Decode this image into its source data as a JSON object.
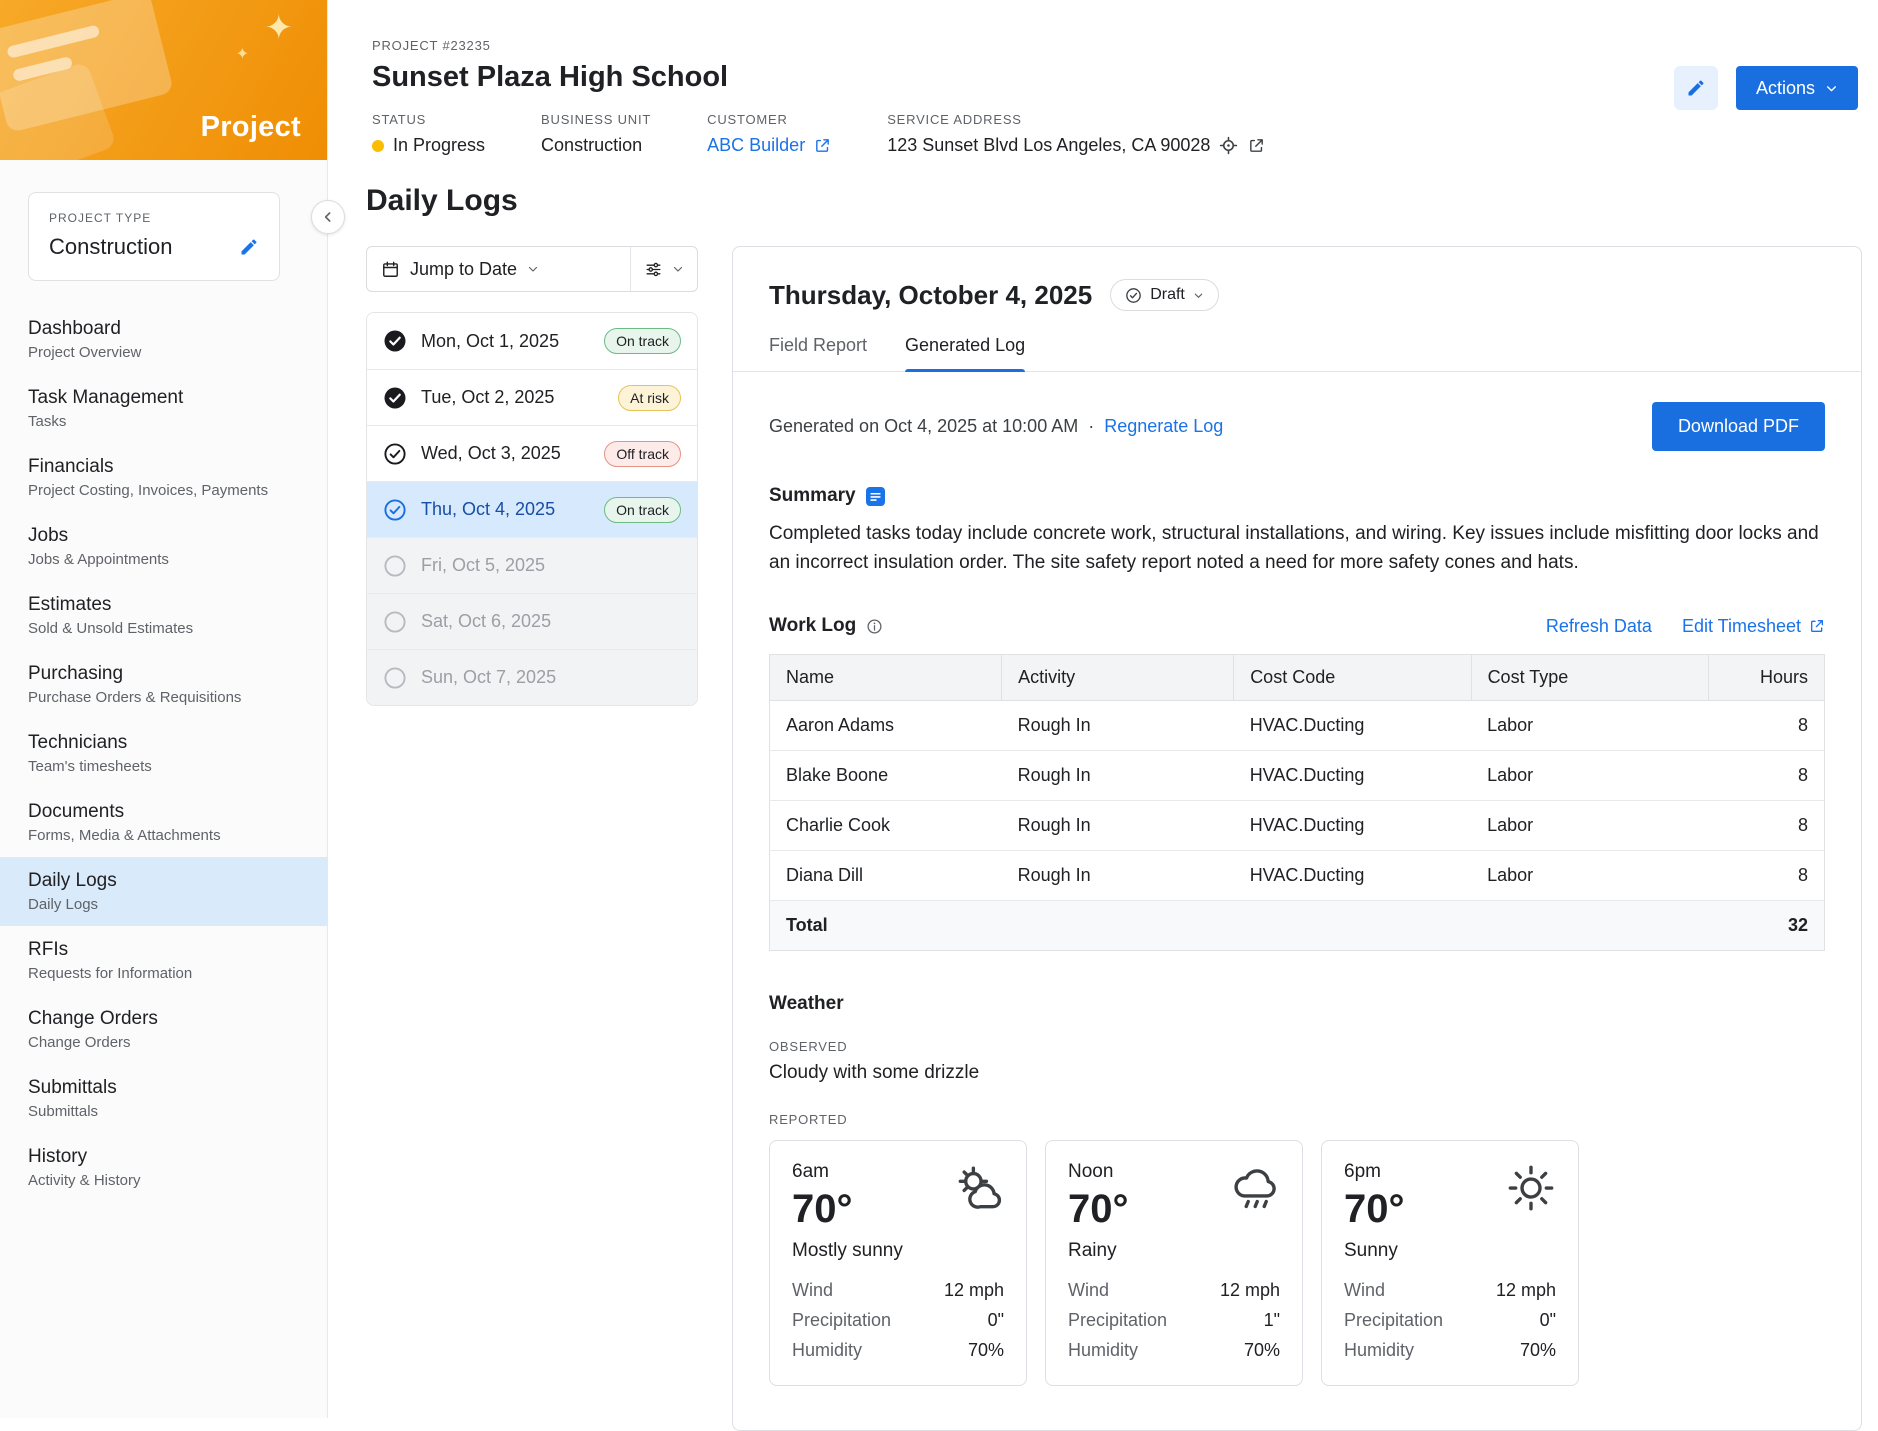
{
  "colors": {
    "accent_blue": "#1a6fe0",
    "link_blue": "#1a73e8",
    "status_yellow": "#fbbc04",
    "selected_row_blue": "#d7e9fc",
    "badge_green_bg": "#e8f5ec",
    "badge_yellow_bg": "#fdf4d8",
    "badge_red_bg": "#fcebe8",
    "logo_orange": "#f09a1c"
  },
  "logo": {
    "text": "Project"
  },
  "sidebar": {
    "project_type": {
      "label": "PROJECT TYPE",
      "value": "Construction"
    },
    "items": [
      {
        "title": "Dashboard",
        "subtitle": "Project Overview"
      },
      {
        "title": "Task Management",
        "subtitle": "Tasks"
      },
      {
        "title": "Financials",
        "subtitle": "Project Costing, Invoices, Payments"
      },
      {
        "title": "Jobs",
        "subtitle": "Jobs & Appointments"
      },
      {
        "title": "Estimates",
        "subtitle": "Sold & Unsold Estimates"
      },
      {
        "title": "Purchasing",
        "subtitle": "Purchase Orders & Requisitions"
      },
      {
        "title": "Technicians",
        "subtitle": "Team's timesheets"
      },
      {
        "title": "Documents",
        "subtitle": "Forms, Media & Attachments"
      },
      {
        "title": "Daily Logs",
        "subtitle": "Daily Logs"
      },
      {
        "title": "RFIs",
        "subtitle": "Requests for Information"
      },
      {
        "title": "Change Orders",
        "subtitle": "Change Orders"
      },
      {
        "title": "Submittals",
        "subtitle": "Submittals"
      },
      {
        "title": "History",
        "subtitle": "Activity & History"
      }
    ]
  },
  "header": {
    "project_number": "PROJECT #23235",
    "title": "Sunset Plaza High School",
    "status_label": "STATUS",
    "status_value": "In Progress",
    "business_unit_label": "BUSINESS UNIT",
    "business_unit_value": "Construction",
    "customer_label": "CUSTOMER",
    "customer_value": "ABC Builder",
    "address_label": "SERVICE ADDRESS",
    "address_value": "123 Sunset Blvd Los Angeles, CA 90028",
    "actions_label": "Actions"
  },
  "page": {
    "title": "Daily Logs"
  },
  "date_picker": {
    "jump_label": "Jump to Date"
  },
  "dates": [
    {
      "label": "Mon, Oct 1, 2025",
      "badge": "On track"
    },
    {
      "label": "Tue, Oct 2, 2025",
      "badge": "At risk"
    },
    {
      "label": "Wed, Oct 3, 2025",
      "badge": "Off track"
    },
    {
      "label": "Thu, Oct 4, 2025",
      "badge": "On track"
    },
    {
      "label": "Fri, Oct 5, 2025"
    },
    {
      "label": "Sat, Oct 6, 2025"
    },
    {
      "label": "Sun, Oct 7, 2025"
    }
  ],
  "log": {
    "date_title": "Thursday, October 4, 2025",
    "status_badge": "Draft",
    "tabs": [
      {
        "label": "Field Report"
      },
      {
        "label": "Generated Log"
      }
    ],
    "generated_text": "Generated on Oct 4, 2025 at 10:00 AM",
    "dot": "·",
    "regenerate_label": "Regnerate Log",
    "download_label": "Download PDF",
    "summary": {
      "title": "Summary",
      "text": "Completed tasks today include concrete work, structural installations, and wiring. Key issues include misfitting door locks and an incorrect insulation order. The site safety report noted a need for more safety cones and hats."
    },
    "work_log": {
      "title": "Work Log",
      "refresh_label": "Refresh Data",
      "edit_label": "Edit Timesheet",
      "columns": [
        "Name",
        "Activity",
        "Cost Code",
        "Cost Type",
        "Hours"
      ],
      "rows": [
        [
          "Aaron Adams",
          "Rough In",
          "HVAC.Ducting",
          "Labor",
          "8"
        ],
        [
          "Blake Boone",
          "Rough In",
          "HVAC.Ducting",
          "Labor",
          "8"
        ],
        [
          "Charlie Cook",
          "Rough In",
          "HVAC.Ducting",
          "Labor",
          "8"
        ],
        [
          "Diana Dill",
          "Rough In",
          "HVAC.Ducting",
          "Labor",
          "8"
        ]
      ],
      "total_label": "Total",
      "total_value": "32"
    },
    "weather": {
      "title": "Weather",
      "observed_label": "OBSERVED",
      "observed_value": "Cloudy with some drizzle",
      "reported_label": "REPORTED",
      "stat_labels": {
        "wind": "Wind",
        "precip": "Precipitation",
        "humidity": "Humidity"
      },
      "cards": [
        {
          "time": "6am",
          "temp": "70°",
          "condition": "Mostly sunny",
          "wind": "12 mph",
          "precip": "0\"",
          "humidity": "70%"
        },
        {
          "time": "Noon",
          "temp": "70°",
          "condition": "Rainy",
          "wind": "12 mph",
          "precip": "1\"",
          "humidity": "70%"
        },
        {
          "time": "6pm",
          "temp": "70°",
          "condition": "Sunny",
          "wind": "12 mph",
          "precip": "0\"",
          "humidity": "70%"
        }
      ]
    }
  }
}
